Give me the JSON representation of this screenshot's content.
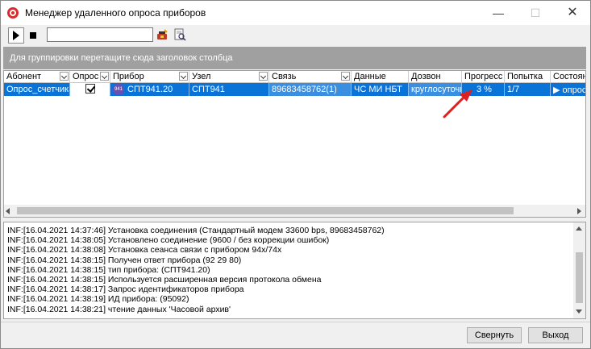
{
  "window": {
    "title": "Менеджер удаленного опроса приборов"
  },
  "group_hint": "Для группировки перетащите сюда заголовок столбца",
  "columns": [
    "Абонент",
    "Опрос",
    "Прибор",
    "Узел",
    "Связь",
    "Данные",
    "Дозвон",
    "Прогресс",
    "Попытка",
    "Состояние"
  ],
  "row": {
    "abonent": "Опрос_счетчика",
    "opros_checked": true,
    "device_badge": "941",
    "device": "СПТ941.20",
    "node": "СПТ941",
    "link": "89683458762(1)",
    "data": "ЧС МИ НБТ",
    "dial": "круглосуточно",
    "progress": "3 %",
    "attempt": "1/7",
    "state": "▶ опрос"
  },
  "log": [
    "INF:[16.04.2021 14:37:46] Установка соединения (Стандартный модем 33600 bps, 89683458762)",
    "INF:[16.04.2021 14:38:05] Установлено соединение (9600 / без коррекции ошибок)",
    "INF:[16.04.2021 14:38:08] Установка сеанса связи с прибором 94x/74x",
    "INF:[16.04.2021 14:38:15] Получен ответ прибора (92 29 80)",
    "INF:[16.04.2021 14:38:15] тип прибора: (СПТ941.20)",
    "INF:[16.04.2021 14:38:15] Используется расширенная версия протокола обмена",
    "INF:[16.04.2021 14:38:17] Запрос идентификаторов прибора",
    "INF:[16.04.2021 14:38:19] ИД прибора: (95092)",
    "INF:[16.04.2021 14:38:21] чтение данных 'Часовой архив'"
  ],
  "buttons": {
    "svernut": "Свернуть",
    "exit": "Выход"
  },
  "colors": {
    "selection": "#0a73d8",
    "group_bar": "#a0a0a0",
    "annotation": "#e02020"
  }
}
